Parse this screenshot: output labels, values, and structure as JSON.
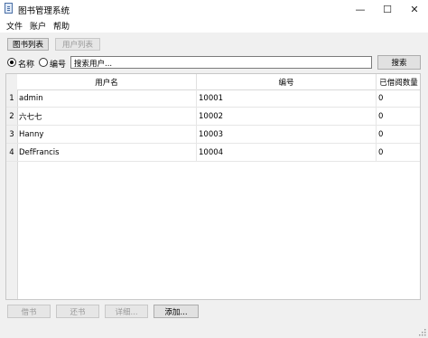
{
  "window": {
    "title": "图书管理系统",
    "minimize_glyph": "—",
    "maximize_glyph": "☐",
    "close_glyph": "✕"
  },
  "menu": [
    "文件",
    "账户",
    "帮助"
  ],
  "tabs": [
    {
      "label": "图书列表",
      "enabled": true
    },
    {
      "label": "用户列表",
      "enabled": false
    }
  ],
  "search": {
    "radio_name_label": "名称",
    "radio_id_label": "编号",
    "selected": "名称",
    "value": "搜索用户...",
    "button_label": "搜索"
  },
  "table": {
    "columns": [
      "用户名",
      "编号",
      "已借阅数量"
    ],
    "rows": [
      {
        "num": "1",
        "cells": [
          "admin",
          "10001",
          "0"
        ]
      },
      {
        "num": "2",
        "cells": [
          "六七七",
          "10002",
          "0"
        ]
      },
      {
        "num": "3",
        "cells": [
          "Hanny",
          "10003",
          "0"
        ]
      },
      {
        "num": "4",
        "cells": [
          "DefFrancis",
          "10004",
          "0"
        ]
      }
    ]
  },
  "actions": [
    {
      "label": "借书",
      "enabled": false
    },
    {
      "label": "还书",
      "enabled": false
    },
    {
      "label": "详细...",
      "enabled": false
    },
    {
      "label": "添加...",
      "enabled": true
    }
  ]
}
